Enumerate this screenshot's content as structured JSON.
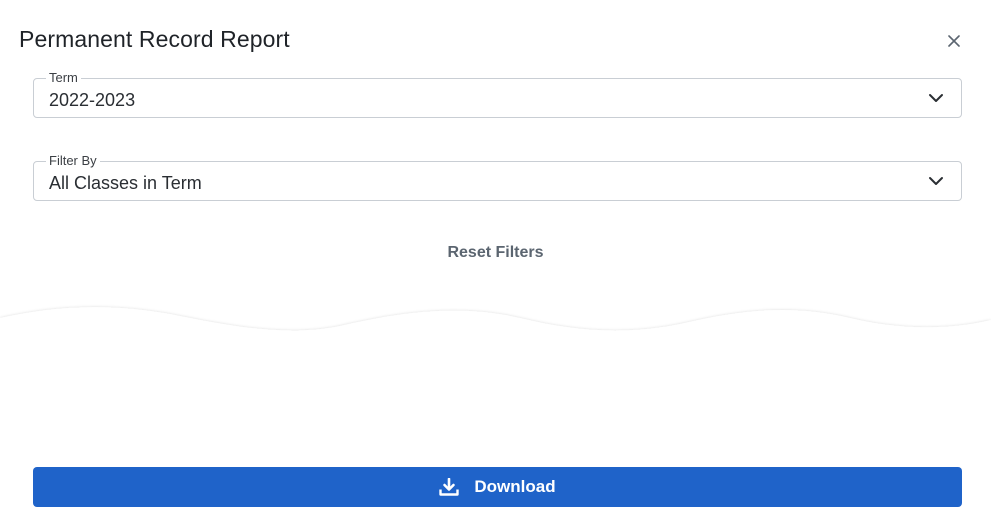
{
  "dialog": {
    "title": "Permanent Record Report",
    "close_icon": "close-icon"
  },
  "term_field": {
    "label": "Term",
    "value": "2022-2023",
    "icon": "chevron-down-icon"
  },
  "filter_field": {
    "label": "Filter By",
    "value": "All Classes in Term",
    "icon": "chevron-down-icon"
  },
  "reset": {
    "label": "Reset Filters"
  },
  "download": {
    "label": "Download",
    "icon": "download-icon",
    "color": "#1f63c9"
  }
}
